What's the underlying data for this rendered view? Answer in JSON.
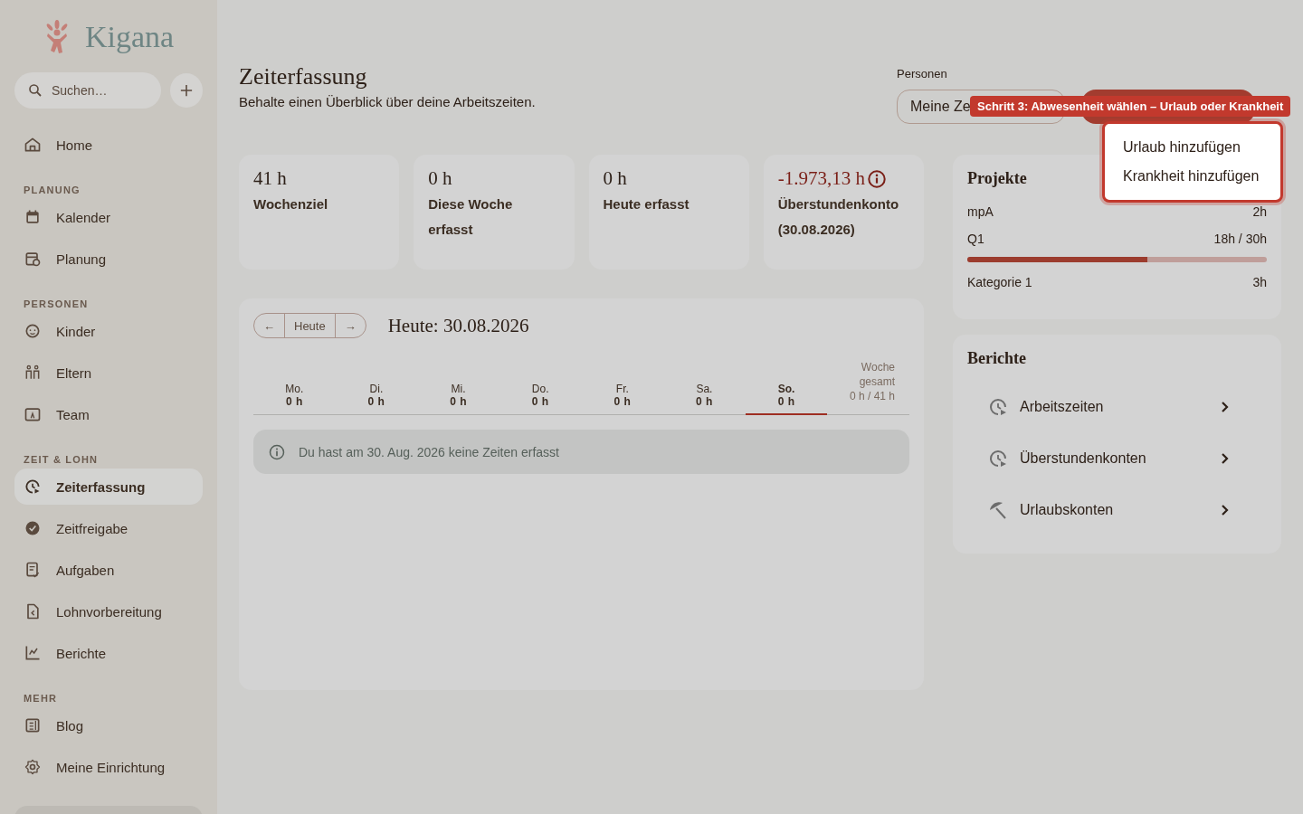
{
  "sidebar": {
    "logo": "Kigana",
    "search": {
      "placeholder": "Suchen…"
    },
    "sections": [
      {
        "items": [
          {
            "label": "Home",
            "selected": false
          }
        ]
      },
      {
        "heading": "PLANUNG",
        "items": [
          {
            "label": "Kalender",
            "selected": false
          },
          {
            "label": "Planung",
            "selected": false
          }
        ]
      },
      {
        "heading": "PERSONEN",
        "items": [
          {
            "label": "Kinder",
            "selected": false
          },
          {
            "label": "Eltern",
            "selected": false
          },
          {
            "label": "Team",
            "selected": false
          }
        ]
      },
      {
        "heading": "ZEIT & LOHN",
        "items": [
          {
            "label": "Zeiterfassung",
            "selected": true
          },
          {
            "label": "Zeitfreigabe",
            "selected": false
          },
          {
            "label": "Aufgaben",
            "selected": false
          },
          {
            "label": "Lohnvorbereitung",
            "selected": false
          },
          {
            "label": "Berichte",
            "selected": false
          }
        ]
      },
      {
        "heading": "MEHR",
        "items": [
          {
            "label": "Blog",
            "selected": false
          },
          {
            "label": "Meine Einrichtung",
            "selected": false
          }
        ]
      }
    ]
  },
  "header": {
    "title": "Zeiterfassung",
    "subtitle": "Behalte einen Überblick über deine Arbeitszeiten.",
    "persons_label": "Personen",
    "person_select": "Meine Ze"
  },
  "stats": [
    {
      "kind": "plain",
      "value": "41 h",
      "label": "Wochenziel"
    },
    {
      "kind": "plain",
      "value": "0 h",
      "label": "Diese Woche erfasst"
    },
    {
      "kind": "plain",
      "value": "0 h",
      "label": "Heute erfasst"
    },
    {
      "kind": "negative",
      "value": "-1.973,13 h",
      "label": "Überstundenkonto (30.08.2026)"
    }
  ],
  "week": {
    "prev": "←",
    "today": "Heute",
    "next": "→",
    "heading": "Heute: 30.08.2026",
    "days": [
      {
        "name": "Mo.",
        "hours": "0 h",
        "selected": false
      },
      {
        "name": "Di.",
        "hours": "0 h",
        "selected": false
      },
      {
        "name": "Mi.",
        "hours": "0 h",
        "selected": false
      },
      {
        "name": "Do.",
        "hours": "0 h",
        "selected": false
      },
      {
        "name": "Fr.",
        "hours": "0 h",
        "selected": false
      },
      {
        "name": "Sa.",
        "hours": "0 h",
        "selected": false
      },
      {
        "name": "So.",
        "hours": "0 h",
        "selected": true
      }
    ],
    "total": {
      "label": "Woche gesamt",
      "value": "0 h / 41 h"
    },
    "notice": "Du hast am 30. Aug. 2026 keine Zeiten erfasst"
  },
  "projects": {
    "title": "Projekte",
    "rows": [
      {
        "kind": "plain",
        "label": "mpA",
        "value": "2h"
      },
      {
        "kind": "bar",
        "label": "Q1",
        "value": "18h / 30h",
        "level": 0.6
      },
      {
        "kind": "plain",
        "label": "Kategorie 1",
        "value": "3h"
      }
    ]
  },
  "reports": {
    "title": "Berichte",
    "items": [
      {
        "label": "Arbeitszeiten"
      },
      {
        "label": "Überstundenkonten"
      },
      {
        "label": "Urlaubskonten"
      }
    ]
  },
  "tour": {
    "tooltip": "Schritt 3: Abwesenheit wählen – Urlaub oder Krankheit",
    "menu": [
      "Urlaub hinzufügen",
      "Krankheit hinzufügen"
    ]
  }
}
